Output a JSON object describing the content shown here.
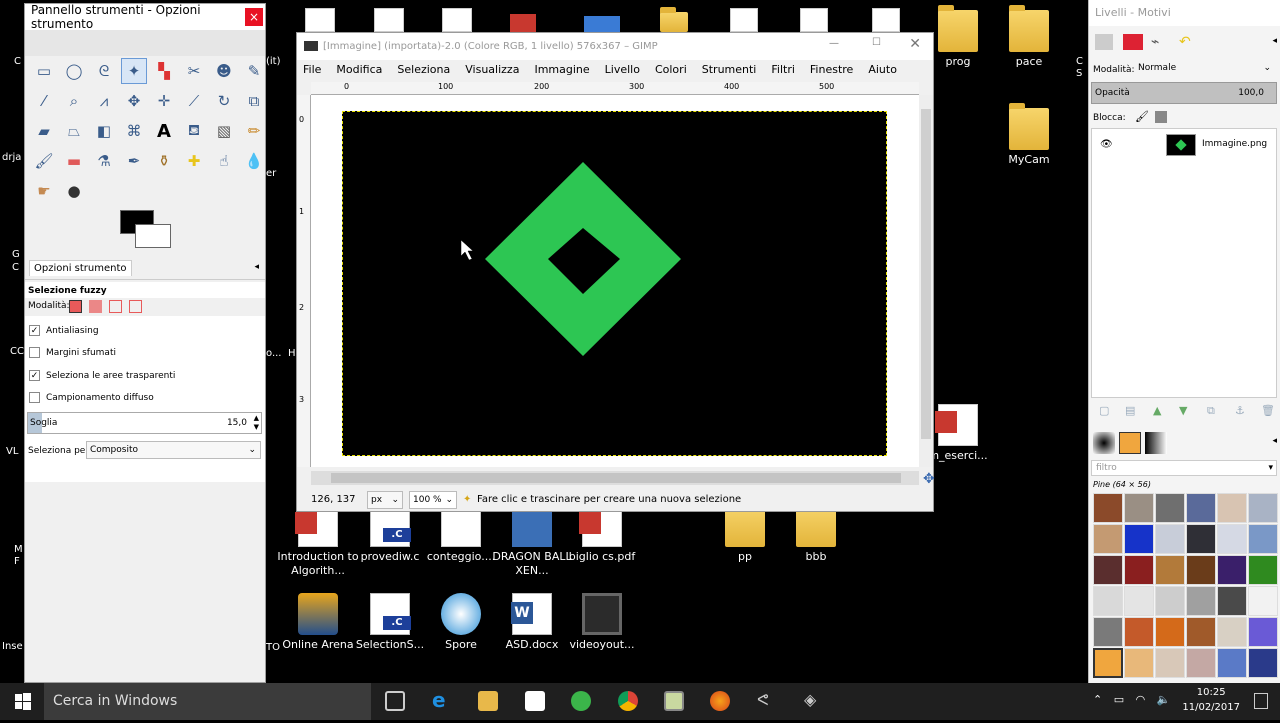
{
  "desktop_icons": [
    {
      "label": "prog",
      "type": "folder"
    },
    {
      "label": "pace",
      "type": "folder"
    },
    {
      "label": "MyCam",
      "type": "folder"
    },
    {
      "label": "Introduction to Algorith...",
      "type": "pdf"
    },
    {
      "label": "provediw.c",
      "type": "cfile"
    },
    {
      "label": "conteggio....",
      "type": "docw"
    },
    {
      "label": "DRAGON BALL XEN...",
      "type": "app"
    },
    {
      "label": "biglio cs.pdf",
      "type": "pdf"
    },
    {
      "label": "pp",
      "type": "folder"
    },
    {
      "label": "bbb",
      "type": "folder"
    },
    {
      "label": "Online Arena",
      "type": "app"
    },
    {
      "label": "SelectionS...",
      "type": "cfile"
    },
    {
      "label": "Spore",
      "type": "app"
    },
    {
      "label": "ASD.docx",
      "type": "word"
    },
    {
      "label": "videoyout...",
      "type": "video"
    },
    {
      "label": "m_eserci...",
      "type": "pdf"
    }
  ],
  "edge_fragments": [
    "C",
    "drja",
    "G",
    "C",
    "CC",
    "VL",
    "M",
    "F",
    "Inse",
    "o...",
    "H",
    "er",
    "TO",
    "C",
    "S",
    "(it)"
  ],
  "toolbox": {
    "title": "Pannello strumenti - Opzioni strumento",
    "close": "×",
    "tool_icons": [
      "rect-select-icon",
      "ellipse-select-icon",
      "free-select-icon",
      "fuzzy-select-icon",
      "color-select-icon",
      "scissors-icon",
      "foreground-select-icon",
      "paths-icon",
      "color-picker-icon",
      "zoom-icon",
      "measure-icon",
      "move-icon",
      "align-icon",
      "crop-icon",
      "rotate-icon",
      "scale-icon",
      "shear-icon",
      "perspective-icon",
      "flip-icon",
      "cage-icon",
      "text-icon",
      "bucket-fill-icon",
      "blend-icon",
      "pencil-icon",
      "paintbrush-icon",
      "eraser-icon",
      "airbrush-icon",
      "ink-icon",
      "clone-icon",
      "heal-icon",
      "smudge-icon",
      "blur-icon",
      "dodge-icon",
      "smudge2-icon"
    ],
    "options_tab": "Opzioni strumento",
    "tool_name": "Selezione fuzzy",
    "mode_label": "Modalità:",
    "antialiasing": "Antialiasing",
    "feather": "Margini sfumati",
    "select_transparent": "Seleziona le aree trasparenti",
    "sample_merged": "Campionamento diffuso",
    "threshold_label": "Soglia",
    "threshold_value": "15,0",
    "threshold_fraction": 0.06,
    "select_by_label": "Seleziona per:",
    "select_by_value": "Composito"
  },
  "image_window": {
    "title": "[Immagine] (importata)-2.0 (Colore RGB, 1 livello) 576x367 – GIMP",
    "menu": [
      "File",
      "Modifica",
      "Seleziona",
      "Visualizza",
      "Immagine",
      "Livello",
      "Colori",
      "Strumenti",
      "Filtri",
      "Finestre",
      "Aiuto"
    ],
    "ruler_h": [
      "0",
      "100",
      "200",
      "300",
      "400",
      "500"
    ],
    "ruler_v": [
      "0",
      "1",
      "2",
      "3"
    ],
    "coords": "126, 137",
    "unit": "px",
    "zoom": "100 %",
    "status": "Fare clic e trascinare per creare una nuova selezione",
    "diamond_color": "#2dc653"
  },
  "layers_dock": {
    "title": "Livelli - Motivi",
    "mode_label": "Modalità:",
    "mode_value": "Normale",
    "opacity_label": "Opacità",
    "opacity_value": "100,0",
    "lock_label": "Blocca:",
    "layer_name": "Immagine.png",
    "filter_placeholder": "filtro",
    "pattern_name": "Pine (64 × 56)"
  },
  "taskbar": {
    "search": "Cerca in Windows",
    "time": "10:25",
    "date": "11/02/2017"
  }
}
